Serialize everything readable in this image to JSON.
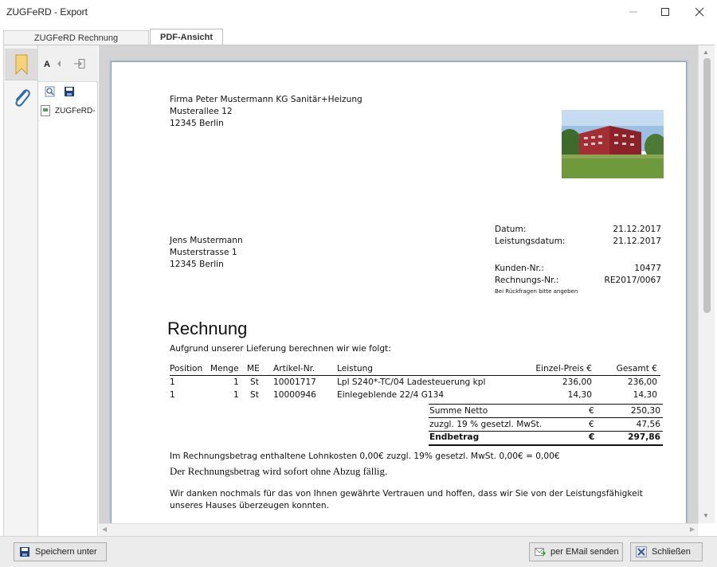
{
  "window": {
    "title": "ZUGFeRD - Export"
  },
  "tabs": [
    {
      "label": "ZUGFeRD Rechnung"
    },
    {
      "label": "PDF-Ansicht"
    }
  ],
  "attachments": {
    "item": "ZUGFeRD-"
  },
  "document": {
    "sender": [
      "Firma Peter Mustermann KG Sanitär+Heizung",
      "Musterallee 12",
      "12345 Berlin"
    ],
    "recipient": [
      "Jens Mustermann",
      "Musterstrasse 1",
      "12345 Berlin"
    ],
    "meta": {
      "datum_label": "Datum:",
      "datum_value": "21.12.2017",
      "leistung_label": "Leistungsdatum:",
      "leistung_value": "21.12.2017",
      "kunden_label": "Kunden-Nr.:",
      "kunden_value": "10477",
      "rechnung_label": "Rechnungs-Nr.:",
      "rechnung_value": "RE2017/0067",
      "hint": "Bei Rückfragen bitte angeben"
    },
    "heading": "Rechnung",
    "intro": "Aufgrund unserer Lieferung berechnen wir wie folgt:",
    "table": {
      "headers": [
        "Position",
        "Menge",
        "ME",
        "Artikel-Nr.",
        "Leistung",
        "Einzel-Preis €",
        "Gesamt €"
      ],
      "rows": [
        [
          "1",
          "1",
          "St",
          "10001717",
          "Lpl S240*-TC/04 Ladesteuerung kpl",
          "236,00",
          "236,00"
        ],
        [
          "1",
          "1",
          "St",
          "10000946",
          "Einlegeblende 22/4 G134",
          "14,30",
          "14,30"
        ]
      ]
    },
    "totals": {
      "netto_label": "Summe Netto",
      "netto_cur": "€",
      "netto_value": "250,30",
      "mwst_label": "zuzgl. 19 % gesetzl. MwSt.",
      "mwst_cur": "€",
      "mwst_value": "47,56",
      "end_label": "Endbetrag",
      "end_cur": "€",
      "end_value": "297,86"
    },
    "lohn_line": "Im Rechnungsbetrag enthaltene Lohnkosten 0,00€  zuzgl. 19% gesetzl. MwSt. 0,00€ = 0,00€",
    "payment_line": "Der Rechnungsbetrag wird sofort ohne Abzug fällig.",
    "thanks_1": "Wir danken nochmals für das von Ihnen gewährte Vertrauen und hoffen, dass wir Sie von der Leistungsfähigkeit",
    "thanks_2": "unseres Hauses überzeugen konnten."
  },
  "buttons": {
    "save": "Speichern unter",
    "email": "per EMail senden",
    "close": "Schließen"
  },
  "icons": [
    "bookmark-icon",
    "paperclip-icon",
    "font-size-icon",
    "arrow-left-icon",
    "export-icon",
    "search-icon",
    "save-icon",
    "file-icon",
    "minimize-icon",
    "maximize-icon",
    "close-icon",
    "email-icon"
  ]
}
